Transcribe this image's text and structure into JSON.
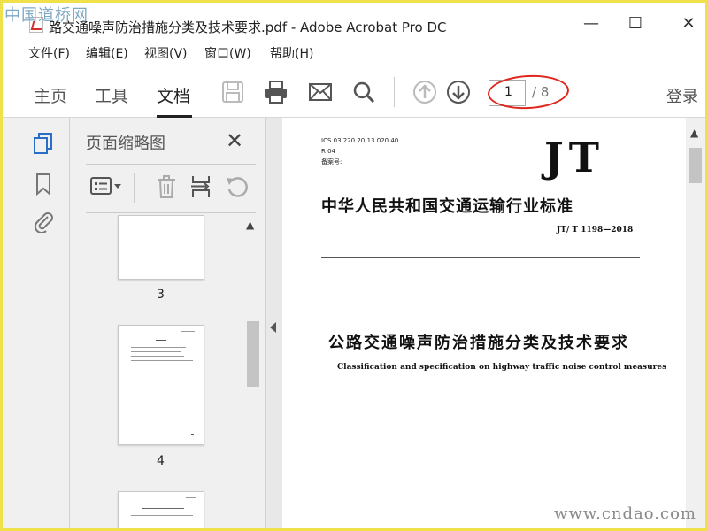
{
  "watermark": {
    "top": "中国道桥网",
    "bottom": "www.cndao.com"
  },
  "window": {
    "title": "路交通噪声防治措施分类及技术要求.pdf - Adobe Acrobat Pro DC",
    "minimize": "—",
    "maximize": "☐",
    "close": "✕"
  },
  "menu": {
    "items": [
      "文件(F)",
      "编辑(E)",
      "视图(V)",
      "窗口(W)",
      "帮助(H)"
    ]
  },
  "toolbar": {
    "tabs": [
      "主页",
      "工具",
      "文档"
    ],
    "active_tab": "文档",
    "icons": [
      "save-icon",
      "print-icon",
      "email-icon",
      "search-icon",
      "page-up-icon",
      "page-down-icon"
    ],
    "current_page": "1",
    "total_pages": "/ 8",
    "login": "登录"
  },
  "sidebar_rail": {
    "icons": [
      "page-thumbnails-icon",
      "bookmark-icon",
      "attachment-icon"
    ]
  },
  "thumbnails_panel": {
    "title": "页面缩略图",
    "close": "✕",
    "tools": [
      "options-menu-icon",
      "delete-icon",
      "insert-page-icon",
      "rotate-icon"
    ],
    "pages": [
      {
        "label": "3"
      },
      {
        "label": "4"
      }
    ]
  },
  "document": {
    "ics_lines": [
      "ICS 03.220.20;13.020.40",
      "R 04",
      "备案号:"
    ],
    "logo": "JT",
    "standard_title": "中华人民共和国交通运输行业标准",
    "standard_number": "JT/ T 1198—2018",
    "cn_title": "公路交通噪声防治措施分类及技术要求",
    "en_title": "Classification and specification on highway traffic noise control measures"
  },
  "colors": {
    "highlight_ellipse": "#e0251b",
    "frame": "#f0e04a"
  }
}
